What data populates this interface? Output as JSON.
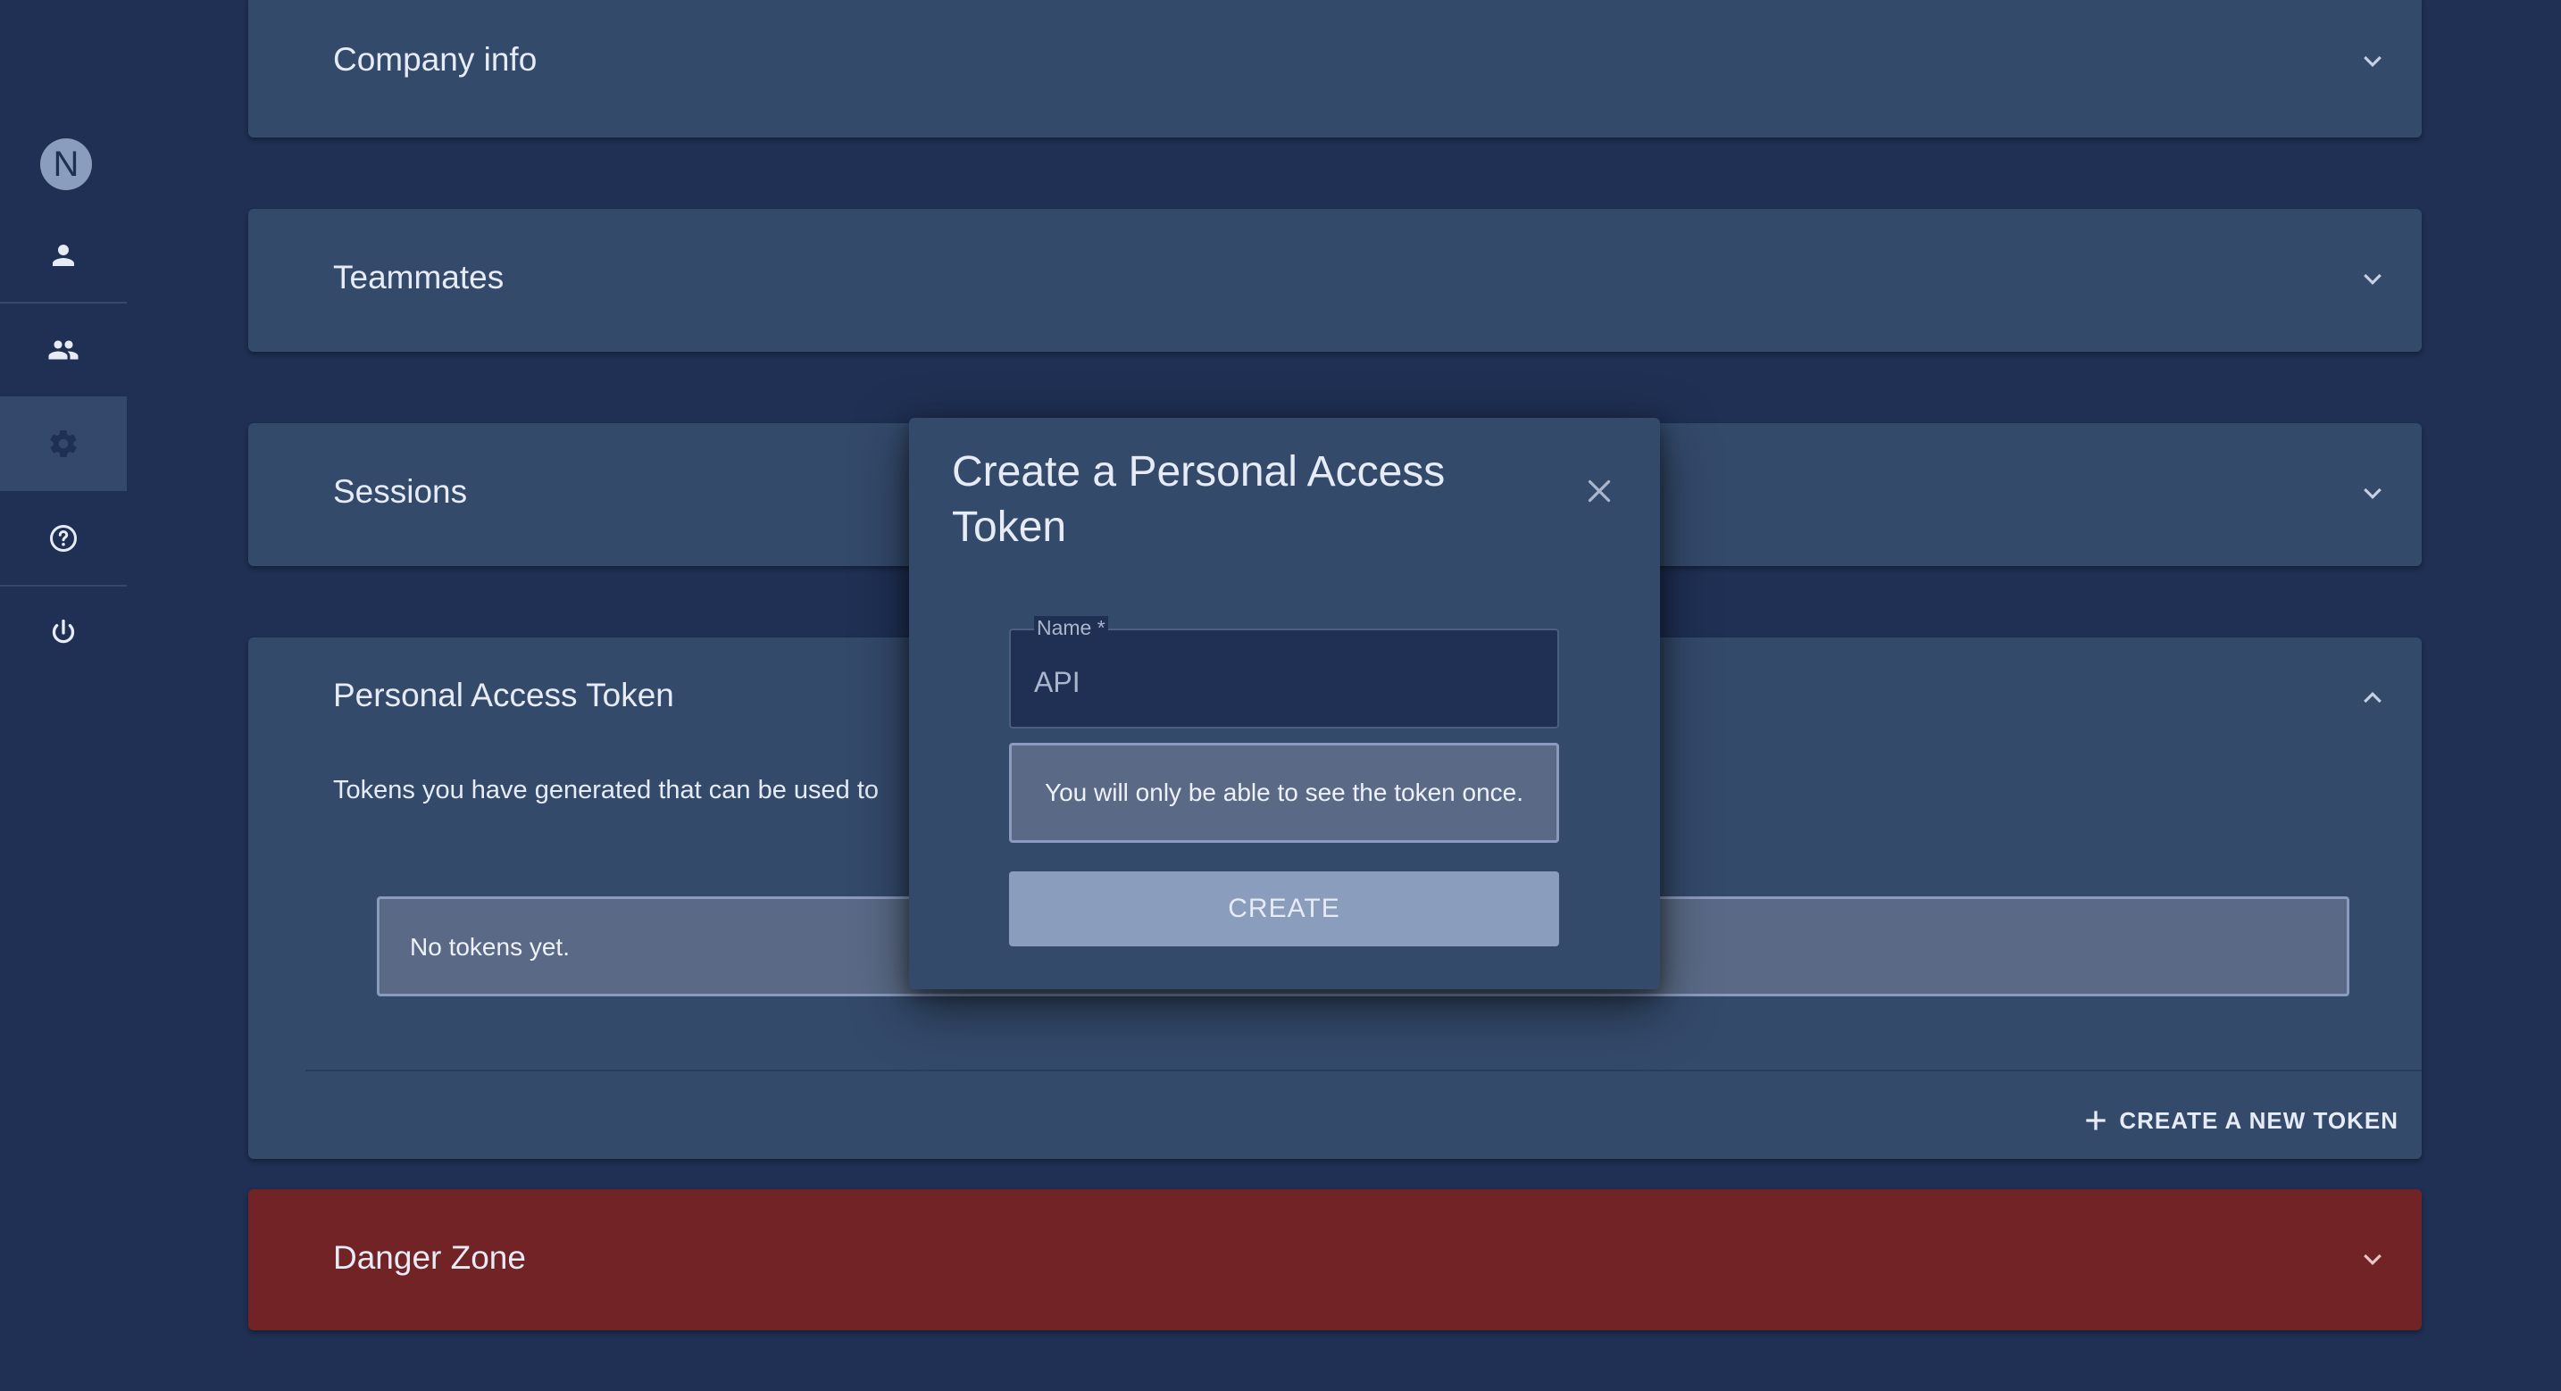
{
  "sidebar": {
    "avatar_initial": "N",
    "items": [
      {
        "icon": "person-icon"
      },
      {
        "icon": "people-icon"
      },
      {
        "icon": "gear-icon",
        "active": true
      },
      {
        "icon": "help-icon"
      },
      {
        "icon": "power-icon"
      }
    ]
  },
  "panels": {
    "company": {
      "title": "Company info"
    },
    "teammates": {
      "title": "Teammates"
    },
    "sessions": {
      "title": "Sessions"
    },
    "pat": {
      "title": "Personal Access Token",
      "description": "Tokens you have generated that can be used to",
      "empty_text": "No tokens yet.",
      "create_new_label": "CREATE A NEW TOKEN"
    },
    "danger": {
      "title": "Danger Zone"
    }
  },
  "modal": {
    "title": "Create a Personal Access Token",
    "name_label": "Name *",
    "name_value": "API",
    "notice": "You will only be able to see the token once.",
    "create_label": "CREATE"
  },
  "colors": {
    "background": "#1f3054",
    "panel": "#344a6b",
    "danger": "#712326",
    "accent": "#8a9dbd"
  }
}
